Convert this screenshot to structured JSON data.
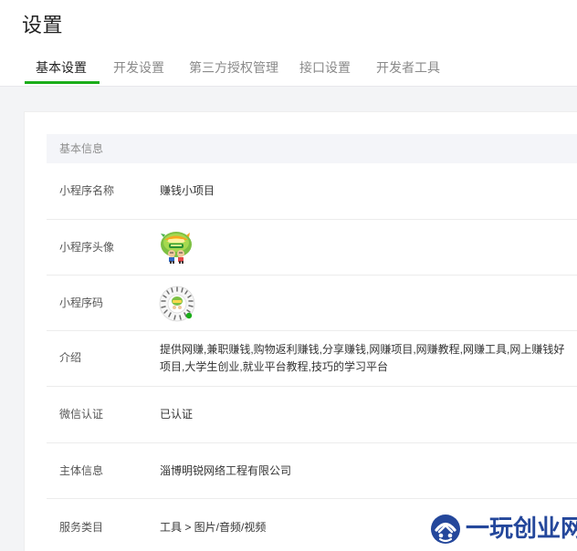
{
  "header": {
    "title": "设置",
    "tabs": [
      {
        "label": "基本设置",
        "active": true
      },
      {
        "label": "开发设置",
        "active": false
      },
      {
        "label": "第三方授权管理",
        "active": false
      },
      {
        "label": "接口设置",
        "active": false
      },
      {
        "label": "开发者工具",
        "active": false
      }
    ]
  },
  "section": {
    "title": "基本信息"
  },
  "rows": {
    "name": {
      "label": "小程序名称",
      "value": "赚钱小项目"
    },
    "avatar": {
      "label": "小程序头像",
      "icon": "mini-program-avatar-icon"
    },
    "qrcode": {
      "label": "小程序码",
      "icon": "mini-program-code-icon"
    },
    "intro": {
      "label": "介绍",
      "value": "提供网赚,兼职赚钱,购物返利赚钱,分享赚钱,网赚项目,网赚教程,网赚工具,网上赚钱好项目,大学生创业,就业平台教程,技巧的学习平台"
    },
    "cert": {
      "label": "微信认证",
      "value": "已认证"
    },
    "entity": {
      "label": "主体信息",
      "value": "淄博明锐网络工程有限公司"
    },
    "category": {
      "label": "服务类目",
      "value": "工具 > 图片/音频/视频"
    }
  },
  "watermark": {
    "text": "一玩创业网",
    "icon": "watermark-logo-icon"
  },
  "colors": {
    "accent": "#1aad19",
    "watermark": "#24479b",
    "section_bg": "#f4f5f9"
  }
}
